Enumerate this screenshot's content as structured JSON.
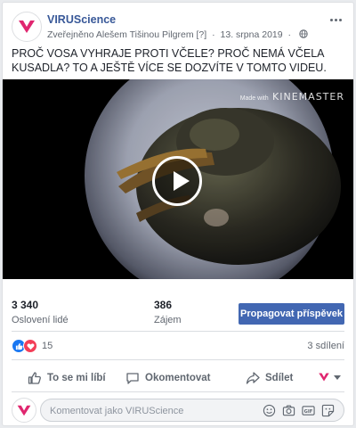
{
  "post": {
    "page_name": "VIRUScience",
    "published_by": "Zveřejněno Alešem Tišinou Pilgrem",
    "published_marker": "[?]",
    "date": "13. srpna 2019",
    "text": "PROČ VOSA VYHRAJE PROTI VČELE? PROČ NEMÁ VČELA KUSADLA? TO A JEŠTĚ VÍCE SE DOZVÍTE V TOMTO VIDEU.",
    "icons": [
      "page-logo-icon",
      "globe-icon",
      "more-options-icon"
    ]
  },
  "video": {
    "watermark_small": "Made with",
    "watermark_big": "KINEMASTER",
    "icon": "play-icon"
  },
  "stats": {
    "reach_value": "3 340",
    "reach_label": "Oslovení lidé",
    "engagement_value": "386",
    "engagement_label": "Zájem",
    "promote_label": "Propagovat příspěvek"
  },
  "reactions": {
    "count": "15",
    "shares": "3 sdílení",
    "icons": [
      "like-reaction-icon",
      "love-reaction-icon"
    ]
  },
  "actions": {
    "like": "To se mi líbí",
    "comment": "Okomentovat",
    "share": "Sdílet"
  },
  "comment": {
    "placeholder": "Komentovat jako VIRUScience",
    "icons": [
      "emoji-icon",
      "camera-icon",
      "gif-icon",
      "sticker-icon"
    ]
  },
  "colors": {
    "brand_blue": "#4267b2",
    "link_blue": "#385898",
    "logo_pink": "#e0266f",
    "love_red": "#f33e58",
    "like_blue": "#1877f2"
  }
}
